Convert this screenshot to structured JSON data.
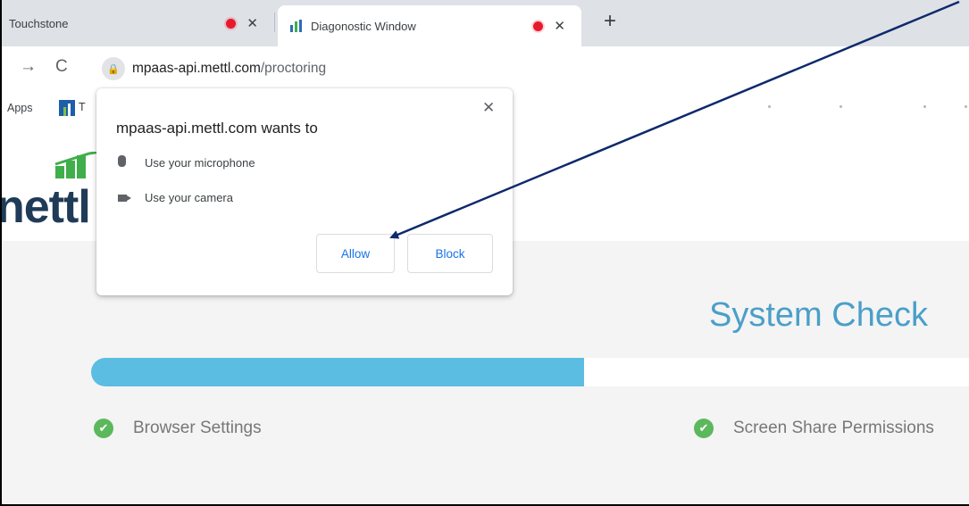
{
  "tabs": [
    {
      "title": "Touchstone",
      "close": "✕"
    },
    {
      "title": "Diagonostic Window",
      "close": "✕"
    }
  ],
  "new_tab": "+",
  "toolbar": {
    "back": "→",
    "reload": "C"
  },
  "address": {
    "host": "mpaas-api.mettl.com",
    "path": "/proctoring"
  },
  "bookmarks": {
    "apps_label": "Apps",
    "item_letter": "T"
  },
  "logo": {
    "text": "nettl"
  },
  "popup": {
    "title": "mpaas-api.mettl.com wants to",
    "close": "✕",
    "permissions": [
      {
        "label": "Use your microphone",
        "icon": "microphone-icon"
      },
      {
        "label": "Use your camera",
        "icon": "camera-icon"
      }
    ],
    "allow_label": "Allow",
    "block_label": "Block"
  },
  "page": {
    "title": "System Check",
    "progress_fraction": 0.56,
    "steps": [
      {
        "label": "Browser Settings",
        "status": "complete"
      },
      {
        "label": "Screen Share Permissions",
        "status": "complete"
      }
    ]
  },
  "colors": {
    "progress_fill": "#5bbde2",
    "title": "#4a9fc9",
    "check": "#5cb85c",
    "button_text": "#1a73e8",
    "annotation_arrow": "#0e2a6b"
  }
}
